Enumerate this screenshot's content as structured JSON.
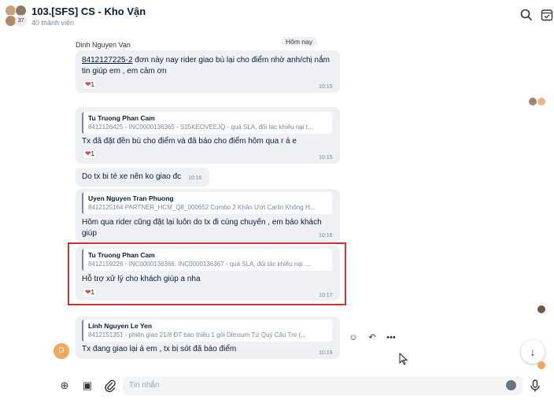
{
  "header": {
    "title": "103.[SFS] CS - Kho Vận",
    "subtitle": "40 thành viên",
    "avatar_count": "37"
  },
  "date_divider": "Hôm nay",
  "messages": [
    {
      "sender": "Dinh Nguyen Van",
      "link": "8412127225-2",
      "text_line1": " đơn này nay rider giao bù lại cho điểm nhờ anh/chị nắm",
      "text_line2": "tin giúp em , em cảm ơn",
      "reaction": "1",
      "time": "10:15"
    },
    {
      "quote_name": "Tu Truong Phan Cam",
      "quote_text": "8412126425 - INC0000136365 - S25KEOVEEJQ - quá SLA, đối tác khiếu nại t...",
      "text": "Tx đã đặt đền bù cho điểm và đã báo cho điểm hôm qua r á e",
      "reaction": "1",
      "time": "10:15"
    },
    {
      "text": "Do tx bi té xe nên ko giao đc",
      "time": "10:16"
    },
    {
      "quote_name": "Uyen Nguyen Tran Phuong",
      "quote_text": "8412125164 PARTNER_HCM_Q8_000652 Combo 2 Khăn Ướt Carlin Không H...",
      "text_line1": "Hôm qua rider cũng đặt lại luôn do tx đi cùng chuyến , em báo khách",
      "text_line2": "giúp",
      "time": "10:16"
    },
    {
      "quote_name": "Tu Truong Phan Cam",
      "quote_text": "8412159226 - INC0000136366, INC0000136367 - quá SLA, đối tác khiếu nại ...",
      "text": "Hỗ trợ xử lý cho khách giúp a nha",
      "reaction": "1",
      "time": "10:17"
    },
    {
      "quote_name": "Linh Nguyen Le Yen",
      "quote_text": "8412151351 - phiên giao 21/8 ĐT báo thiếu 1 gói Dimsum Tứ Quý Cầu Tre (...",
      "text": "Tx đang giao lại á em , tx bị sót đã báo điểm",
      "time": "10:19",
      "avatar_letter": "D"
    }
  ],
  "composer": {
    "placeholder": "Tin nhắn"
  },
  "colors": {
    "bubble": "#eef0f3",
    "highlight": "#d23232",
    "heart": "#e2434b",
    "avatar_d": "#f2a65a"
  },
  "icons": [
    "search-icon",
    "todo-icon",
    "heart-icon",
    "emoji-reaction-icon",
    "reply-icon",
    "more-icon",
    "scroll-down-icon",
    "plus-icon",
    "sticker-icon",
    "attach-icon",
    "emoji-icon",
    "mic-icon"
  ]
}
